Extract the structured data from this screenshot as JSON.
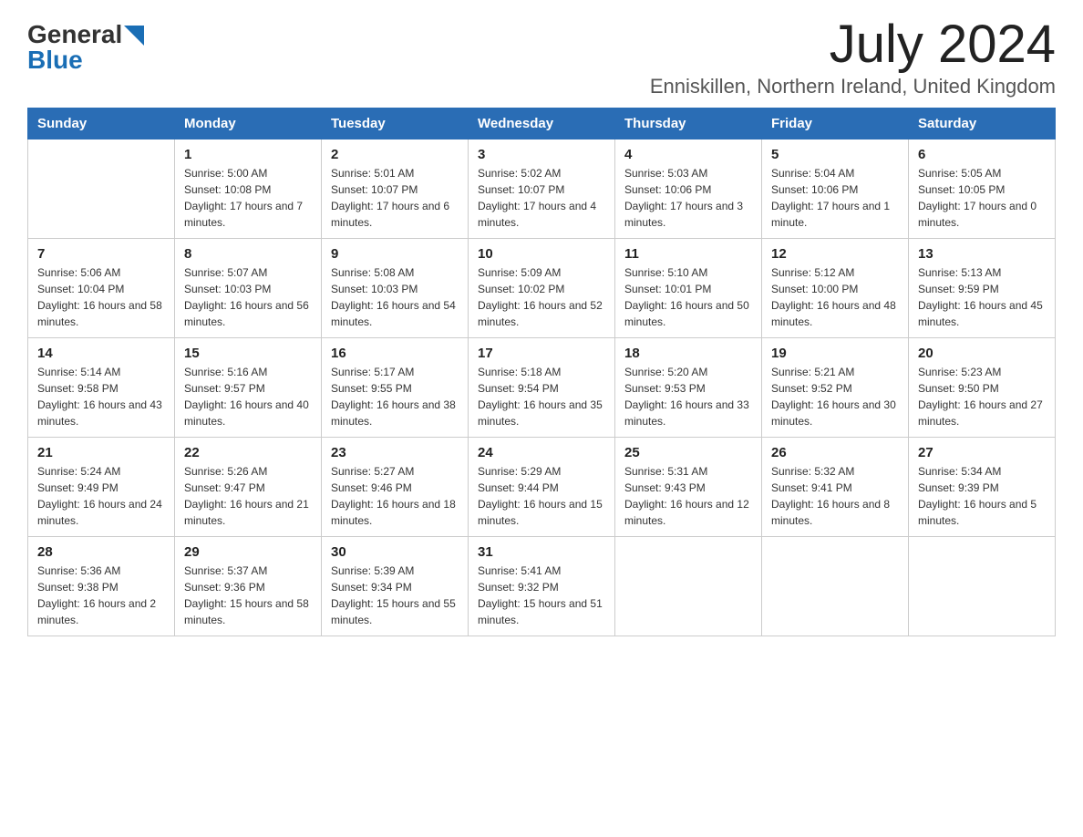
{
  "logo": {
    "part1": "General",
    "part2": "Blue"
  },
  "title": "July 2024",
  "location": "Enniskillen, Northern Ireland, United Kingdom",
  "days_of_week": [
    "Sunday",
    "Monday",
    "Tuesday",
    "Wednesday",
    "Thursday",
    "Friday",
    "Saturday"
  ],
  "weeks": [
    [
      {
        "day": "",
        "sunrise": "",
        "sunset": "",
        "daylight": ""
      },
      {
        "day": "1",
        "sunrise": "Sunrise: 5:00 AM",
        "sunset": "Sunset: 10:08 PM",
        "daylight": "Daylight: 17 hours and 7 minutes."
      },
      {
        "day": "2",
        "sunrise": "Sunrise: 5:01 AM",
        "sunset": "Sunset: 10:07 PM",
        "daylight": "Daylight: 17 hours and 6 minutes."
      },
      {
        "day": "3",
        "sunrise": "Sunrise: 5:02 AM",
        "sunset": "Sunset: 10:07 PM",
        "daylight": "Daylight: 17 hours and 4 minutes."
      },
      {
        "day": "4",
        "sunrise": "Sunrise: 5:03 AM",
        "sunset": "Sunset: 10:06 PM",
        "daylight": "Daylight: 17 hours and 3 minutes."
      },
      {
        "day": "5",
        "sunrise": "Sunrise: 5:04 AM",
        "sunset": "Sunset: 10:06 PM",
        "daylight": "Daylight: 17 hours and 1 minute."
      },
      {
        "day": "6",
        "sunrise": "Sunrise: 5:05 AM",
        "sunset": "Sunset: 10:05 PM",
        "daylight": "Daylight: 17 hours and 0 minutes."
      }
    ],
    [
      {
        "day": "7",
        "sunrise": "Sunrise: 5:06 AM",
        "sunset": "Sunset: 10:04 PM",
        "daylight": "Daylight: 16 hours and 58 minutes."
      },
      {
        "day": "8",
        "sunrise": "Sunrise: 5:07 AM",
        "sunset": "Sunset: 10:03 PM",
        "daylight": "Daylight: 16 hours and 56 minutes."
      },
      {
        "day": "9",
        "sunrise": "Sunrise: 5:08 AM",
        "sunset": "Sunset: 10:03 PM",
        "daylight": "Daylight: 16 hours and 54 minutes."
      },
      {
        "day": "10",
        "sunrise": "Sunrise: 5:09 AM",
        "sunset": "Sunset: 10:02 PM",
        "daylight": "Daylight: 16 hours and 52 minutes."
      },
      {
        "day": "11",
        "sunrise": "Sunrise: 5:10 AM",
        "sunset": "Sunset: 10:01 PM",
        "daylight": "Daylight: 16 hours and 50 minutes."
      },
      {
        "day": "12",
        "sunrise": "Sunrise: 5:12 AM",
        "sunset": "Sunset: 10:00 PM",
        "daylight": "Daylight: 16 hours and 48 minutes."
      },
      {
        "day": "13",
        "sunrise": "Sunrise: 5:13 AM",
        "sunset": "Sunset: 9:59 PM",
        "daylight": "Daylight: 16 hours and 45 minutes."
      }
    ],
    [
      {
        "day": "14",
        "sunrise": "Sunrise: 5:14 AM",
        "sunset": "Sunset: 9:58 PM",
        "daylight": "Daylight: 16 hours and 43 minutes."
      },
      {
        "day": "15",
        "sunrise": "Sunrise: 5:16 AM",
        "sunset": "Sunset: 9:57 PM",
        "daylight": "Daylight: 16 hours and 40 minutes."
      },
      {
        "day": "16",
        "sunrise": "Sunrise: 5:17 AM",
        "sunset": "Sunset: 9:55 PM",
        "daylight": "Daylight: 16 hours and 38 minutes."
      },
      {
        "day": "17",
        "sunrise": "Sunrise: 5:18 AM",
        "sunset": "Sunset: 9:54 PM",
        "daylight": "Daylight: 16 hours and 35 minutes."
      },
      {
        "day": "18",
        "sunrise": "Sunrise: 5:20 AM",
        "sunset": "Sunset: 9:53 PM",
        "daylight": "Daylight: 16 hours and 33 minutes."
      },
      {
        "day": "19",
        "sunrise": "Sunrise: 5:21 AM",
        "sunset": "Sunset: 9:52 PM",
        "daylight": "Daylight: 16 hours and 30 minutes."
      },
      {
        "day": "20",
        "sunrise": "Sunrise: 5:23 AM",
        "sunset": "Sunset: 9:50 PM",
        "daylight": "Daylight: 16 hours and 27 minutes."
      }
    ],
    [
      {
        "day": "21",
        "sunrise": "Sunrise: 5:24 AM",
        "sunset": "Sunset: 9:49 PM",
        "daylight": "Daylight: 16 hours and 24 minutes."
      },
      {
        "day": "22",
        "sunrise": "Sunrise: 5:26 AM",
        "sunset": "Sunset: 9:47 PM",
        "daylight": "Daylight: 16 hours and 21 minutes."
      },
      {
        "day": "23",
        "sunrise": "Sunrise: 5:27 AM",
        "sunset": "Sunset: 9:46 PM",
        "daylight": "Daylight: 16 hours and 18 minutes."
      },
      {
        "day": "24",
        "sunrise": "Sunrise: 5:29 AM",
        "sunset": "Sunset: 9:44 PM",
        "daylight": "Daylight: 16 hours and 15 minutes."
      },
      {
        "day": "25",
        "sunrise": "Sunrise: 5:31 AM",
        "sunset": "Sunset: 9:43 PM",
        "daylight": "Daylight: 16 hours and 12 minutes."
      },
      {
        "day": "26",
        "sunrise": "Sunrise: 5:32 AM",
        "sunset": "Sunset: 9:41 PM",
        "daylight": "Daylight: 16 hours and 8 minutes."
      },
      {
        "day": "27",
        "sunrise": "Sunrise: 5:34 AM",
        "sunset": "Sunset: 9:39 PM",
        "daylight": "Daylight: 16 hours and 5 minutes."
      }
    ],
    [
      {
        "day": "28",
        "sunrise": "Sunrise: 5:36 AM",
        "sunset": "Sunset: 9:38 PM",
        "daylight": "Daylight: 16 hours and 2 minutes."
      },
      {
        "day": "29",
        "sunrise": "Sunrise: 5:37 AM",
        "sunset": "Sunset: 9:36 PM",
        "daylight": "Daylight: 15 hours and 58 minutes."
      },
      {
        "day": "30",
        "sunrise": "Sunrise: 5:39 AM",
        "sunset": "Sunset: 9:34 PM",
        "daylight": "Daylight: 15 hours and 55 minutes."
      },
      {
        "day": "31",
        "sunrise": "Sunrise: 5:41 AM",
        "sunset": "Sunset: 9:32 PM",
        "daylight": "Daylight: 15 hours and 51 minutes."
      },
      {
        "day": "",
        "sunrise": "",
        "sunset": "",
        "daylight": ""
      },
      {
        "day": "",
        "sunrise": "",
        "sunset": "",
        "daylight": ""
      },
      {
        "day": "",
        "sunrise": "",
        "sunset": "",
        "daylight": ""
      }
    ]
  ]
}
